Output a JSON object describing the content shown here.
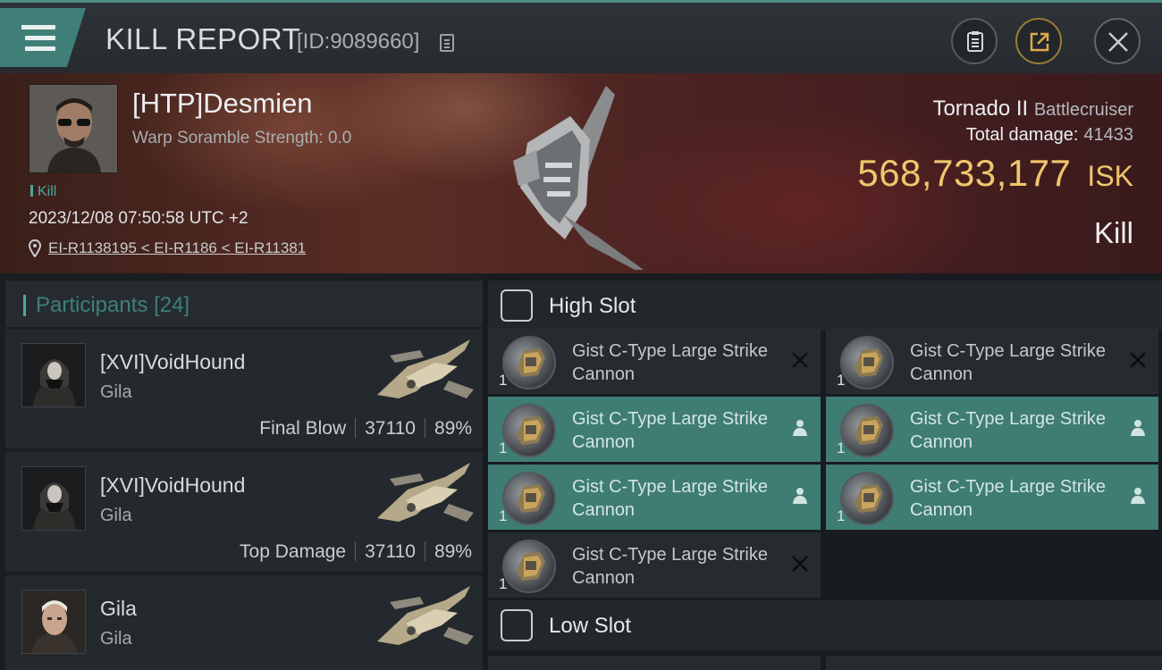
{
  "header": {
    "title": "KILL REPORT",
    "report_id": "[ID:9089660]"
  },
  "victim": {
    "name": "[HTP]Desmien",
    "scramble": "Warp Soramble Strength: 0.0",
    "report_type": "Kill",
    "datetime": "2023/12/08 07:50:58 UTC +2",
    "location": "EI-R1138195 < EI-R1186 < EI-R11381",
    "ship_name": "Tornado II",
    "ship_class": "Battlecruiser",
    "total_damage_label": "Total damage:",
    "total_damage": "41433",
    "isk_value": "568,733,177",
    "isk_unit": "ISK",
    "result": "Kill"
  },
  "participants": {
    "label": "Participants",
    "count": "[24]",
    "rows": [
      {
        "name": "[XVI]VoidHound",
        "corp": "Gila",
        "tag": "Final Blow",
        "damage": "37110",
        "pct": "89%"
      },
      {
        "name": "[XVI]VoidHound",
        "corp": "Gila",
        "tag": "Top Damage",
        "damage": "37110",
        "pct": "89%"
      },
      {
        "name": "Gila",
        "corp": "Gila"
      }
    ]
  },
  "slots": {
    "high_label": "High Slot",
    "low_label": "Low Slot",
    "high_modules": [
      {
        "qty": "1",
        "name": "Gist C-Type Large Strike Cannon",
        "state": "destroyed"
      },
      {
        "qty": "1",
        "name": "Gist C-Type Large Strike Cannon",
        "state": "destroyed"
      },
      {
        "qty": "1",
        "name": "Gist C-Type Large Strike Cannon",
        "state": "dropped"
      },
      {
        "qty": "1",
        "name": "Gist C-Type Large Strike Cannon",
        "state": "dropped"
      },
      {
        "qty": "1",
        "name": "Gist C-Type Large Strike Cannon",
        "state": "dropped"
      },
      {
        "qty": "1",
        "name": "Gist C-Type Large Strike Cannon",
        "state": "dropped"
      },
      {
        "qty": "1",
        "name": "Gist C-Type Large Strike Cannon",
        "state": "destroyed"
      }
    ]
  },
  "colors": {
    "accent_teal": "#3f7f78",
    "isk_gold": "#f0c66e"
  }
}
